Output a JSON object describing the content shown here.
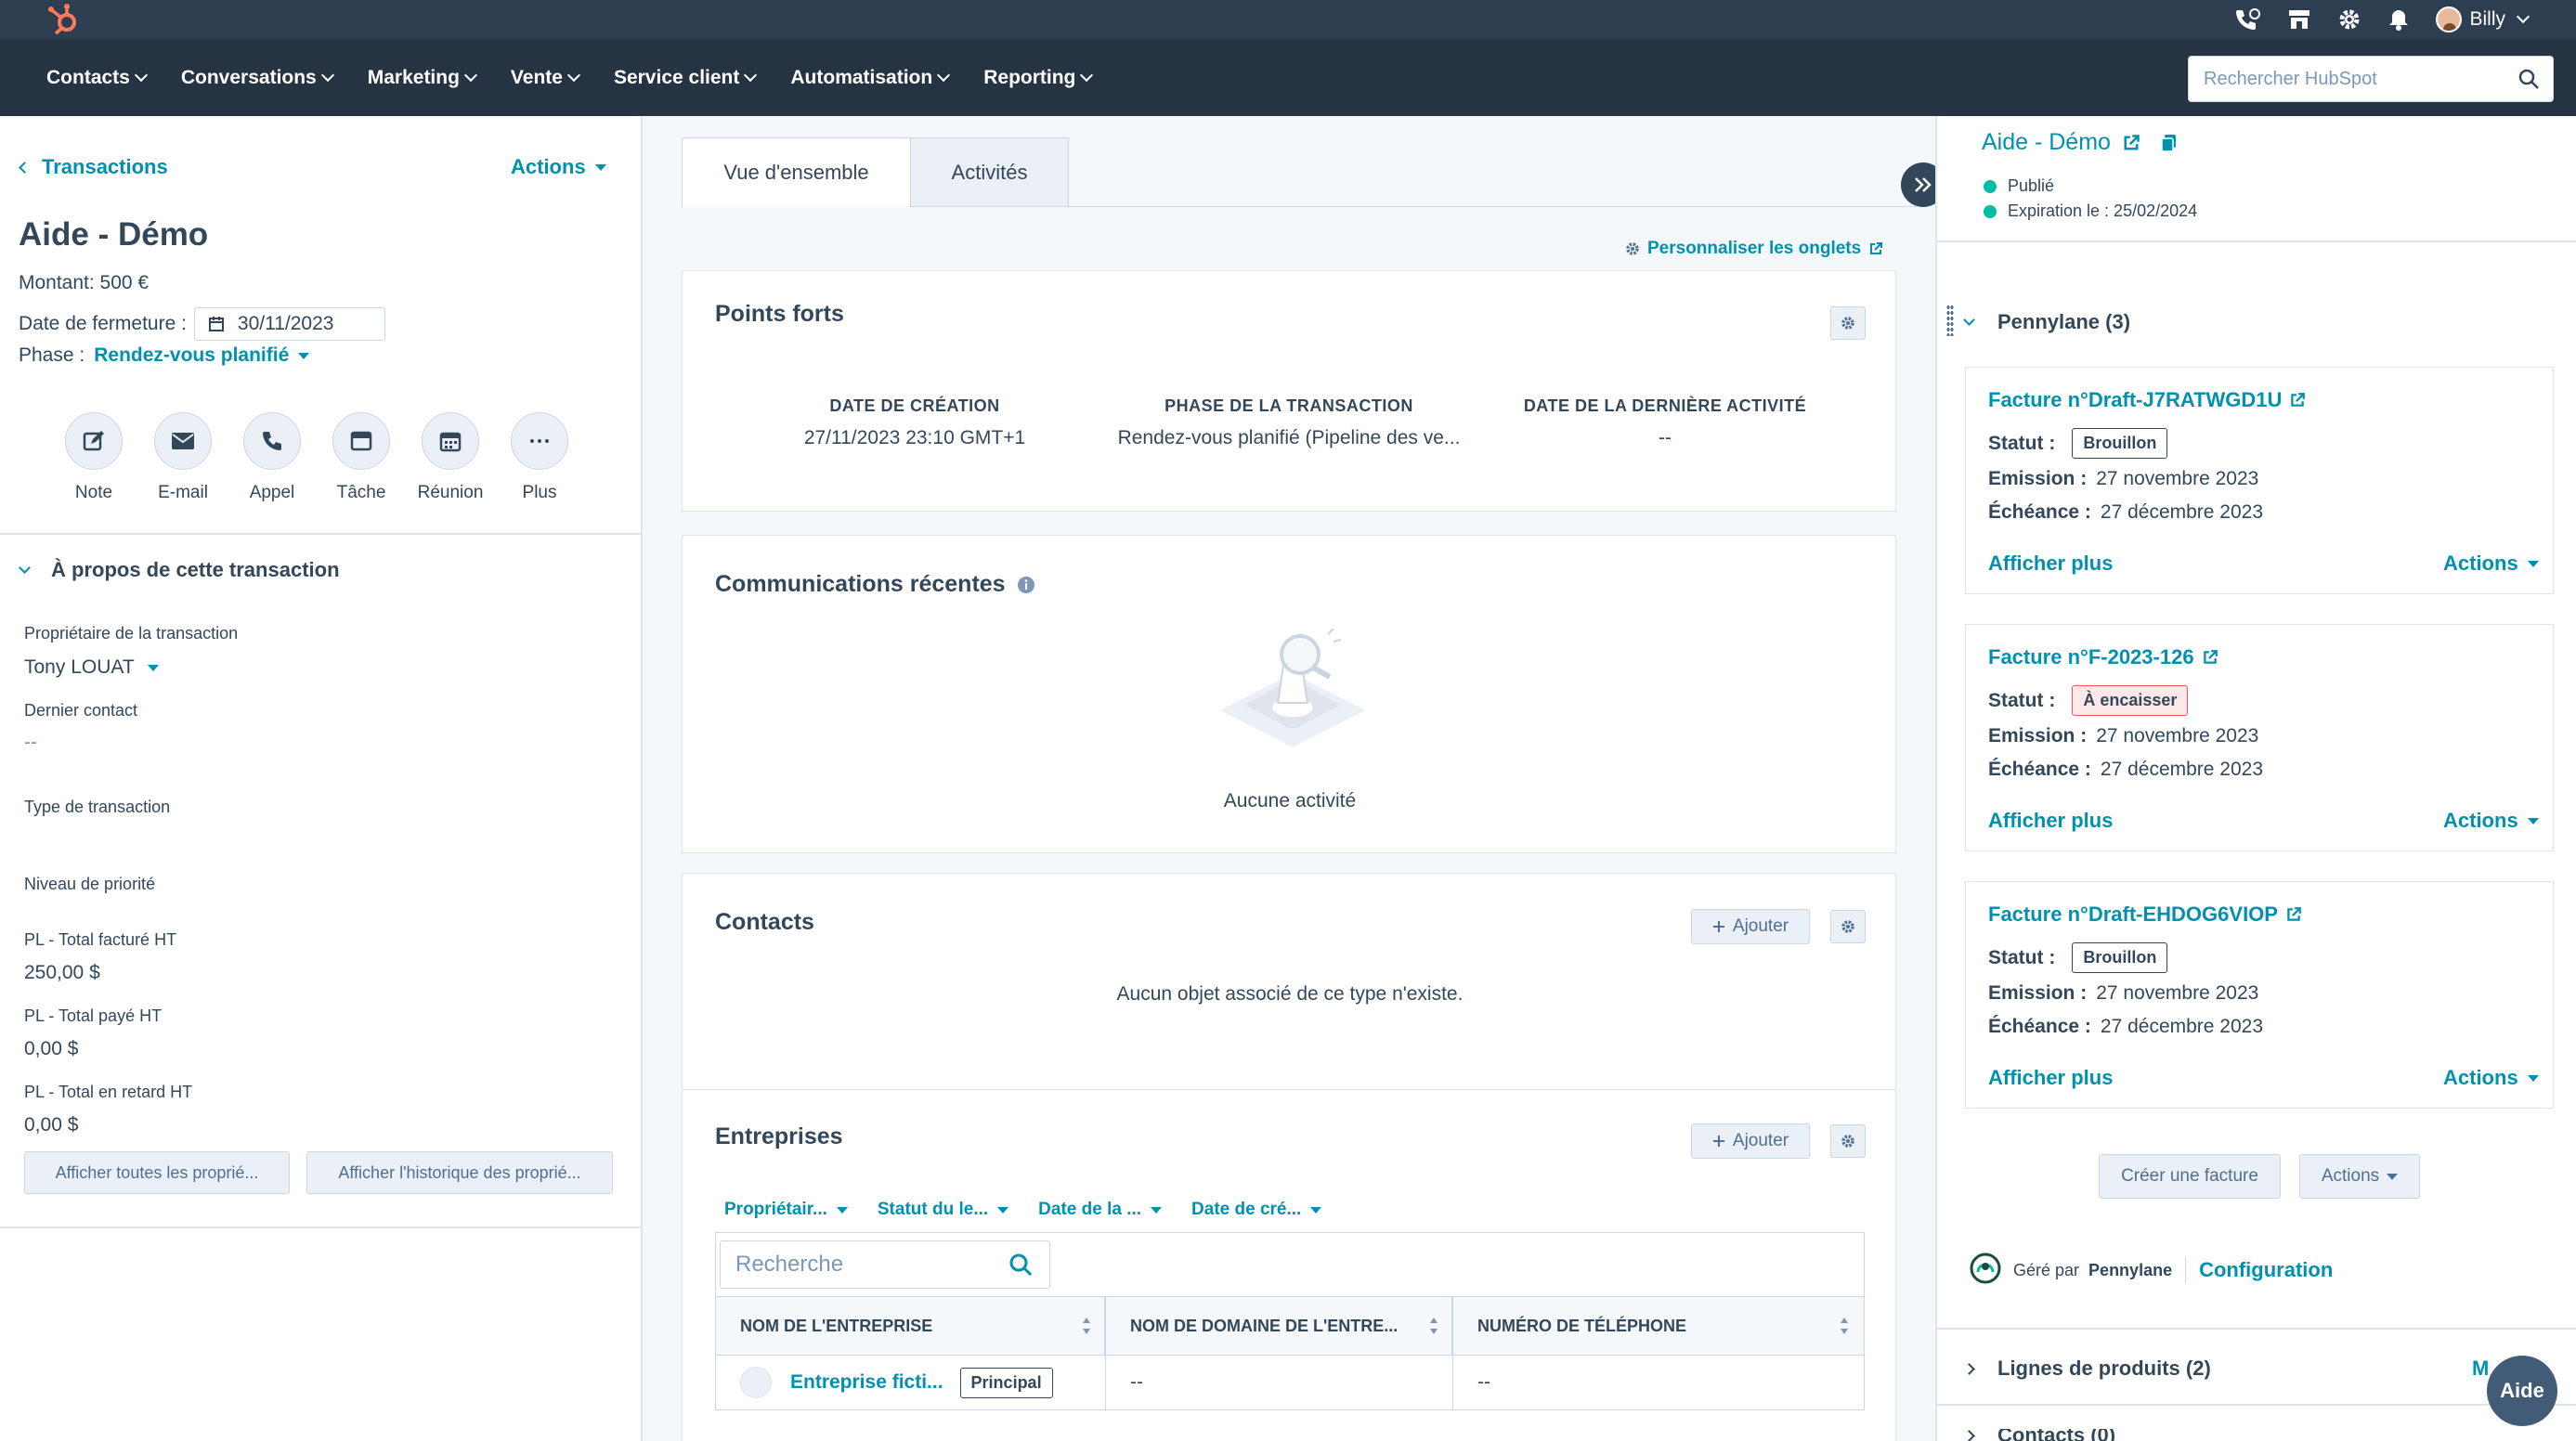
{
  "topbar": {
    "user_name": "Billy",
    "search_placeholder": "Rechercher HubSpot",
    "nav": [
      "Contacts",
      "Conversations",
      "Marketing",
      "Vente",
      "Service client",
      "Automatisation",
      "Reporting"
    ]
  },
  "left": {
    "back_label": "Transactions",
    "actions_label": "Actions",
    "title": "Aide - Démo",
    "amount": "Montant: 500 €",
    "close_date_label": "Date de fermeture :",
    "close_date_value": "30/11/2023",
    "phase_label": "Phase :",
    "phase_value": "Rendez-vous planifié",
    "activities": [
      "Note",
      "E-mail",
      "Appel",
      "Tâche",
      "Réunion",
      "Plus"
    ],
    "about_title": "À propos de cette transaction",
    "props": {
      "owner_label": "Propriétaire de la transaction",
      "owner_value": "Tony LOUAT",
      "last_contact_label": "Dernier contact",
      "last_contact_value": "--",
      "type_label": "Type de transaction",
      "priority_label": "Niveau de priorité",
      "billed_label": "PL - Total facturé HT",
      "billed_value": "250,00 $",
      "paid_label": "PL - Total payé HT",
      "paid_value": "0,00 $",
      "late_label": "PL - Total en retard HT",
      "late_value": "0,00 $"
    },
    "show_all_props": "Afficher toutes les proprié...",
    "show_history": "Afficher l'historique des proprié..."
  },
  "middle": {
    "tabs": [
      "Vue d'ensemble",
      "Activités"
    ],
    "customize_tabs": "Personnaliser les onglets",
    "highlights": {
      "title": "Points forts",
      "items": [
        {
          "label": "DATE DE CRÉATION",
          "value": "27/11/2023 23:10 GMT+1"
        },
        {
          "label": "PHASE DE LA TRANSACTION",
          "value": "Rendez-vous planifié (Pipeline des ve..."
        },
        {
          "label": "DATE DE LA DERNIÈRE ACTIVITÉ",
          "value": "--"
        }
      ]
    },
    "recent": {
      "title": "Communications récentes",
      "empty": "Aucune activité"
    },
    "contacts": {
      "title": "Contacts",
      "add": "Ajouter",
      "empty": "Aucun objet associé de ce type n'existe."
    },
    "companies": {
      "title": "Entreprises",
      "add": "Ajouter",
      "filters": [
        "Propriétair...",
        "Statut du le...",
        "Date de la ...",
        "Date de cré..."
      ],
      "search_placeholder": "Recherche",
      "columns": [
        "NOM DE L'ENTREPRISE",
        "NOM DE DOMAINE DE L'ENTRE...",
        "NUMÉRO DE TÉLÉPHONE"
      ],
      "row": {
        "name": "Entreprise ficti...",
        "badge": "Principal",
        "domain": "--",
        "phone": "--"
      }
    }
  },
  "right": {
    "title": "Aide - Démo",
    "published": "Publié",
    "expiration": "Expiration le : 25/02/2024",
    "pennylane_title": "Pennylane (3)",
    "statut_label": "Statut :",
    "emission_label": "Emission :",
    "echeance_label": "Échéance :",
    "more_label": "Afficher plus",
    "actions_label": "Actions",
    "invoices": [
      {
        "title": "Facture n°Draft-J7RATWGD1U",
        "status": "Brouillon",
        "emission": "27 novembre 2023",
        "echeance": "27 décembre 2023"
      },
      {
        "title": "Facture n°F-2023-126",
        "status": "À encaisser",
        "emission": "27 novembre 2023",
        "echeance": "27 décembre 2023"
      },
      {
        "title": "Facture n°Draft-EHDOG6VIOP",
        "status": "Brouillon",
        "emission": "27 novembre 2023",
        "echeance": "27 décembre 2023"
      }
    ],
    "create_invoice": "Créer une facture",
    "actions_btn": "Actions",
    "managed_by": "Géré par",
    "managed_brand": "Pennylane",
    "configuration": "Configuration",
    "product_lines": "Lignes de produits (2)",
    "product_lines_link": "M",
    "contacts_partial": "Contacts (0)"
  },
  "help_button": "Aide",
  "colors": {
    "accent": "#0091ae",
    "nav_dark": "#2d3e50",
    "nav": "#253342",
    "success": "#00bda5",
    "danger": "#f2545b",
    "hubspot_orange": "#ff7a59"
  }
}
